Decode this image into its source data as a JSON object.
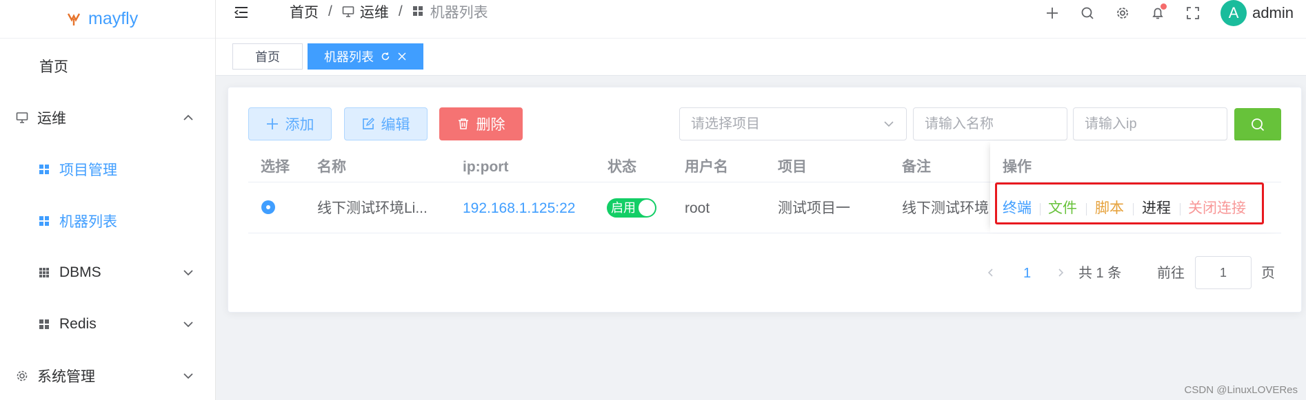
{
  "app": {
    "name": "mayfly"
  },
  "sidebar": {
    "items": [
      {
        "label": "首页"
      },
      {
        "label": "运维"
      },
      {
        "label": "项目管理"
      },
      {
        "label": "机器列表"
      },
      {
        "label": "DBMS"
      },
      {
        "label": "Redis"
      },
      {
        "label": "系统管理"
      }
    ]
  },
  "header": {
    "breadcrumb": [
      "首页",
      "运维",
      "机器列表"
    ],
    "user": {
      "avatar_letter": "A",
      "name": "admin"
    },
    "icons": [
      "plus-icon",
      "search-icon",
      "gear-icon",
      "bell-icon",
      "fullscreen-icon"
    ]
  },
  "tags": {
    "home": "首页",
    "current": "机器列表"
  },
  "toolbar": {
    "add_label": "添加",
    "edit_label": "编辑",
    "delete_label": "删除",
    "project_placeholder": "请选择项目",
    "name_placeholder": "请输入名称",
    "ip_placeholder": "请输入ip"
  },
  "table": {
    "columns": [
      "选择",
      "名称",
      "ip:port",
      "状态",
      "用户名",
      "项目",
      "备注",
      "操作"
    ],
    "rows": [
      {
        "name": "线下测试环境Li...",
        "ip_port": "192.168.1.125:22",
        "status": "启用",
        "username": "root",
        "project": "测试项目一",
        "remark": "线下测试环境"
      }
    ],
    "actions": [
      "终端",
      "文件",
      "脚本",
      "进程",
      "关闭连接"
    ]
  },
  "pagination": {
    "current_page": "1",
    "total_text": "共 1 条",
    "goto_label": "前往",
    "goto_value": "1",
    "page_unit": "页"
  },
  "watermark": "CSDN @LinuxLOVERes",
  "colors": {
    "primary": "#409eff",
    "success": "#67c23a",
    "danger": "#f56c6c",
    "warning": "#e6a23c",
    "switch_on": "#13ce66",
    "highlight_box": "#e8191f"
  }
}
